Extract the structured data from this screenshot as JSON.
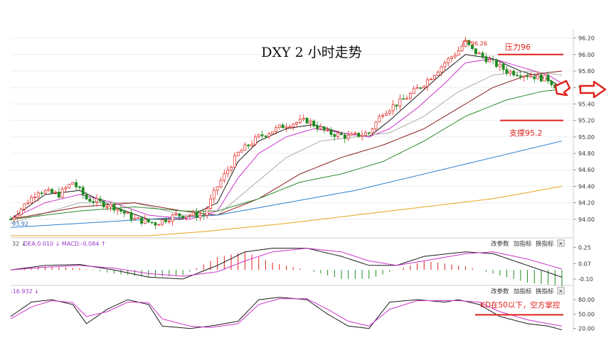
{
  "chart_data": {
    "type": "candlestick",
    "title": "DXY 2 小时走势",
    "y_axis": {
      "ylim": [
        93.8,
        96.3
      ],
      "ticks": [
        "96.20",
        "96.00",
        "95.80",
        "95.60",
        "95.40",
        "95.20",
        "95.00",
        "94.80",
        "94.60",
        "94.40",
        "94.20",
        "94.00"
      ]
    },
    "annotations": {
      "peak_label": "96.26",
      "peak_value": 96.26,
      "low_label": "93.92",
      "resistance_label": "压力96",
      "resistance_value": 96.0,
      "support_label": "支撑95.2",
      "support_value": 95.2,
      "kd_note": "KD在50以下，空方掌控"
    },
    "price_keypoints": [
      [
        0,
        94.0
      ],
      [
        8,
        94.35
      ],
      [
        14,
        94.3
      ],
      [
        18,
        94.45
      ],
      [
        22,
        94.25
      ],
      [
        30,
        94.15
      ],
      [
        36,
        94.0
      ],
      [
        42,
        93.95
      ],
      [
        48,
        94.05
      ],
      [
        56,
        94.05
      ],
      [
        60,
        94.4
      ],
      [
        66,
        94.8
      ],
      [
        72,
        95.0
      ],
      [
        80,
        95.15
      ],
      [
        86,
        95.2
      ],
      [
        92,
        95.05
      ],
      [
        98,
        95.0
      ],
      [
        104,
        95.05
      ],
      [
        108,
        95.3
      ],
      [
        114,
        95.45
      ],
      [
        120,
        95.65
      ],
      [
        126,
        95.9
      ],
      [
        130,
        96.05
      ],
      [
        132,
        96.15
      ],
      [
        134,
        96.05
      ],
      [
        138,
        95.95
      ],
      [
        144,
        95.8
      ],
      [
        150,
        95.75
      ],
      [
        156,
        95.7
      ],
      [
        160,
        95.55
      ]
    ],
    "moving_averages": [
      {
        "color": "#1a1a1a",
        "keypoints": [
          [
            0,
            94.0
          ],
          [
            10,
            94.3
          ],
          [
            20,
            94.35
          ],
          [
            30,
            94.15
          ],
          [
            40,
            94.0
          ],
          [
            50,
            94.0
          ],
          [
            60,
            94.2
          ],
          [
            66,
            94.7
          ],
          [
            72,
            94.95
          ],
          [
            80,
            95.1
          ],
          [
            88,
            95.15
          ],
          [
            96,
            95.05
          ],
          [
            104,
            95.0
          ],
          [
            110,
            95.2
          ],
          [
            118,
            95.5
          ],
          [
            126,
            95.8
          ],
          [
            132,
            96.0
          ],
          [
            140,
            95.95
          ],
          [
            148,
            95.8
          ],
          [
            156,
            95.7
          ],
          [
            160,
            95.6
          ]
        ]
      },
      {
        "color": "#cc33cc",
        "keypoints": [
          [
            0,
            94.0
          ],
          [
            10,
            94.2
          ],
          [
            20,
            94.3
          ],
          [
            30,
            94.2
          ],
          [
            40,
            94.05
          ],
          [
            52,
            94.0
          ],
          [
            60,
            94.1
          ],
          [
            66,
            94.5
          ],
          [
            72,
            94.8
          ],
          [
            80,
            95.0
          ],
          [
            88,
            95.1
          ],
          [
            96,
            95.05
          ],
          [
            104,
            95.0
          ],
          [
            110,
            95.1
          ],
          [
            118,
            95.35
          ],
          [
            126,
            95.65
          ],
          [
            132,
            95.9
          ],
          [
            140,
            95.95
          ],
          [
            148,
            95.85
          ],
          [
            156,
            95.75
          ],
          [
            160,
            95.65
          ]
        ]
      },
      {
        "color": "#aaaaaa",
        "keypoints": [
          [
            0,
            93.95
          ],
          [
            20,
            94.2
          ],
          [
            36,
            94.2
          ],
          [
            50,
            94.05
          ],
          [
            60,
            94.05
          ],
          [
            70,
            94.4
          ],
          [
            80,
            94.75
          ],
          [
            90,
            94.95
          ],
          [
            100,
            95.0
          ],
          [
            110,
            95.05
          ],
          [
            120,
            95.25
          ],
          [
            130,
            95.55
          ],
          [
            140,
            95.75
          ],
          [
            150,
            95.8
          ],
          [
            160,
            95.75
          ]
        ]
      },
      {
        "color": "#8a1f1f",
        "keypoints": [
          [
            0,
            94.0
          ],
          [
            20,
            94.15
          ],
          [
            36,
            94.2
          ],
          [
            50,
            94.1
          ],
          [
            60,
            94.05
          ],
          [
            72,
            94.25
          ],
          [
            84,
            94.55
          ],
          [
            96,
            94.75
          ],
          [
            108,
            94.9
          ],
          [
            120,
            95.1
          ],
          [
            130,
            95.35
          ],
          [
            140,
            95.6
          ],
          [
            150,
            95.75
          ],
          [
            160,
            95.8
          ]
        ]
      },
      {
        "color": "#2e8b2e",
        "keypoints": [
          [
            0,
            94.0
          ],
          [
            20,
            94.1
          ],
          [
            36,
            94.15
          ],
          [
            50,
            94.1
          ],
          [
            60,
            94.1
          ],
          [
            72,
            94.25
          ],
          [
            84,
            94.45
          ],
          [
            96,
            94.55
          ],
          [
            108,
            94.7
          ],
          [
            120,
            94.95
          ],
          [
            132,
            95.25
          ],
          [
            144,
            95.45
          ],
          [
            154,
            95.55
          ],
          [
            160,
            95.58
          ]
        ]
      },
      {
        "color": "#2b7fd0",
        "keypoints": [
          [
            0,
            93.9
          ],
          [
            20,
            93.95
          ],
          [
            40,
            94.0
          ],
          [
            60,
            94.05
          ],
          [
            80,
            94.2
          ],
          [
            100,
            94.35
          ],
          [
            120,
            94.55
          ],
          [
            140,
            94.75
          ],
          [
            160,
            94.95
          ]
        ]
      },
      {
        "color": "#e8a31c",
        "keypoints": [
          [
            0,
            93.8
          ],
          [
            20,
            93.8
          ],
          [
            40,
            93.8
          ],
          [
            56,
            93.85
          ],
          [
            80,
            93.95
          ],
          [
            100,
            94.05
          ],
          [
            120,
            94.15
          ],
          [
            140,
            94.25
          ],
          [
            160,
            94.4
          ]
        ]
      }
    ],
    "macd": {
      "label": "DEA:0.010 ↓ MACD:-0.084 ↑",
      "label_prefix": "32 ↓",
      "ticks": [
        "0.25",
        "0.07",
        "-0.10"
      ],
      "ylim": [
        -0.14,
        0.3
      ],
      "dif_keypoints": [
        [
          0,
          0.0
        ],
        [
          10,
          0.05
        ],
        [
          20,
          0.06
        ],
        [
          30,
          0.0
        ],
        [
          40,
          -0.08
        ],
        [
          50,
          -0.1
        ],
        [
          60,
          0.05
        ],
        [
          68,
          0.2
        ],
        [
          76,
          0.24
        ],
        [
          86,
          0.24
        ],
        [
          96,
          0.15
        ],
        [
          104,
          0.05
        ],
        [
          112,
          0.05
        ],
        [
          120,
          0.15
        ],
        [
          132,
          0.2
        ],
        [
          140,
          0.18
        ],
        [
          150,
          0.05
        ],
        [
          160,
          -0.08
        ]
      ],
      "dea_keypoints": [
        [
          0,
          0.0
        ],
        [
          10,
          0.03
        ],
        [
          20,
          0.05
        ],
        [
          30,
          0.02
        ],
        [
          40,
          -0.04
        ],
        [
          50,
          -0.07
        ],
        [
          60,
          -0.02
        ],
        [
          68,
          0.1
        ],
        [
          76,
          0.2
        ],
        [
          86,
          0.24
        ],
        [
          96,
          0.2
        ],
        [
          104,
          0.1
        ],
        [
          112,
          0.05
        ],
        [
          120,
          0.1
        ],
        [
          132,
          0.18
        ],
        [
          140,
          0.2
        ],
        [
          150,
          0.12
        ],
        [
          160,
          0.01
        ]
      ],
      "zero": 0.0
    },
    "kdj": {
      "label": ":16.932 ↓",
      "ticks": [
        "80.00",
        "50.00",
        "20.00"
      ],
      "ylim": [
        15,
        95
      ],
      "k_keypoints": [
        [
          0,
          45
        ],
        [
          6,
          75
        ],
        [
          12,
          80
        ],
        [
          18,
          70
        ],
        [
          22,
          30
        ],
        [
          28,
          60
        ],
        [
          34,
          80
        ],
        [
          40,
          70
        ],
        [
          44,
          25
        ],
        [
          52,
          20
        ],
        [
          58,
          25
        ],
        [
          66,
          35
        ],
        [
          72,
          80
        ],
        [
          78,
          85
        ],
        [
          86,
          80
        ],
        [
          92,
          50
        ],
        [
          98,
          25
        ],
        [
          104,
          20
        ],
        [
          110,
          75
        ],
        [
          118,
          80
        ],
        [
          126,
          75
        ],
        [
          130,
          80
        ],
        [
          136,
          70
        ],
        [
          142,
          45
        ],
        [
          150,
          30
        ],
        [
          156,
          25
        ],
        [
          160,
          17
        ]
      ],
      "d_keypoints": [
        [
          0,
          40
        ],
        [
          6,
          65
        ],
        [
          12,
          78
        ],
        [
          18,
          74
        ],
        [
          22,
          45
        ],
        [
          28,
          55
        ],
        [
          34,
          75
        ],
        [
          40,
          74
        ],
        [
          44,
          40
        ],
        [
          52,
          25
        ],
        [
          58,
          22
        ],
        [
          66,
          30
        ],
        [
          72,
          70
        ],
        [
          78,
          82
        ],
        [
          86,
          82
        ],
        [
          92,
          60
        ],
        [
          98,
          35
        ],
        [
          104,
          25
        ],
        [
          110,
          60
        ],
        [
          118,
          78
        ],
        [
          126,
          78
        ],
        [
          130,
          78
        ],
        [
          136,
          75
        ],
        [
          142,
          55
        ],
        [
          150,
          38
        ],
        [
          156,
          30
        ],
        [
          160,
          25
        ]
      ]
    }
  },
  "toolbar": {
    "change_params": "改参数",
    "add_indicator": "加指标",
    "switch_indicator": "换指标",
    "close": "✕"
  }
}
